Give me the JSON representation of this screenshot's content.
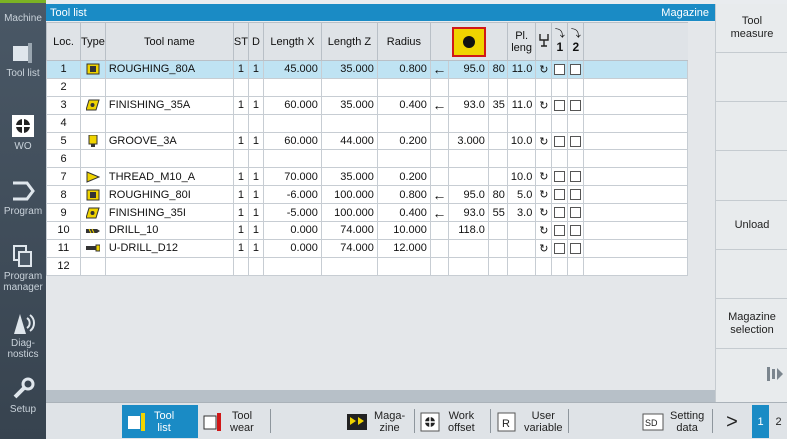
{
  "sidebar": {
    "items": [
      {
        "label": "Machine",
        "icon": "machine-icon"
      },
      {
        "label": "Tool list",
        "icon": "tool-list-icon"
      },
      {
        "label": "WO",
        "icon": "wo-icon"
      },
      {
        "label": "Program",
        "icon": "program-icon"
      },
      {
        "label": "Program\nmanager",
        "icon": "program-manager-icon"
      },
      {
        "label": "Diag-\nnostics",
        "icon": "diagnostics-icon"
      },
      {
        "label": "Setup",
        "icon": "setup-icon"
      }
    ]
  },
  "header": {
    "title": "Tool list",
    "right": "Magazine"
  },
  "table": {
    "columns": [
      "Loc.",
      "Type",
      "Tool name",
      "ST",
      "D",
      "Length X",
      "Length Z",
      "Radius",
      "",
      "Pl. leng",
      "",
      "1",
      "2"
    ],
    "rows": [
      {
        "loc": "1",
        "type": "roughing",
        "name": "ROUGHING_80A",
        "st": "1",
        "d": "1",
        "lx": "45.000",
        "lz": "35.000",
        "rad": "0.800",
        "dir": "←",
        "v1": "95.0",
        "v2": "80",
        "pl": "11.0",
        "sp": "↻",
        "selected": true
      },
      {
        "loc": "2",
        "type": "",
        "name": "",
        "st": "",
        "d": "",
        "lx": "",
        "lz": "",
        "rad": "",
        "dir": "",
        "v1": "",
        "v2": "",
        "pl": "",
        "sp": ""
      },
      {
        "loc": "3",
        "type": "finishing",
        "name": "FINISHING_35A",
        "st": "1",
        "d": "1",
        "lx": "60.000",
        "lz": "35.000",
        "rad": "0.400",
        "dir": "←",
        "v1": "93.0",
        "v2": "35",
        "pl": "11.0",
        "sp": "↻"
      },
      {
        "loc": "4",
        "type": "",
        "name": "",
        "st": "",
        "d": "",
        "lx": "",
        "lz": "",
        "rad": "",
        "dir": "",
        "v1": "",
        "v2": "",
        "pl": "",
        "sp": ""
      },
      {
        "loc": "5",
        "type": "groove",
        "name": "GROOVE_3A",
        "st": "1",
        "d": "1",
        "lx": "60.000",
        "lz": "44.000",
        "rad": "0.200",
        "dir": "",
        "v1": "3.000",
        "v2": "",
        "pl": "10.0",
        "sp": "↻"
      },
      {
        "loc": "6",
        "type": "",
        "name": "",
        "st": "",
        "d": "",
        "lx": "",
        "lz": "",
        "rad": "",
        "dir": "",
        "v1": "",
        "v2": "",
        "pl": "",
        "sp": ""
      },
      {
        "loc": "7",
        "type": "thread",
        "name": "THREAD_M10_A",
        "st": "1",
        "d": "1",
        "lx": "70.000",
        "lz": "35.000",
        "rad": "0.200",
        "dir": "",
        "v1": "",
        "v2": "",
        "pl": "10.0",
        "sp": "↻"
      },
      {
        "loc": "8",
        "type": "roughing",
        "name": "ROUGHING_80I",
        "st": "1",
        "d": "1",
        "lx": "-6.000",
        "lz": "100.000",
        "rad": "0.800",
        "dir": "←",
        "v1": "95.0",
        "v2": "80",
        "pl": "5.0",
        "sp": "↻"
      },
      {
        "loc": "9",
        "type": "finishing",
        "name": "FINISHING_35I",
        "st": "1",
        "d": "1",
        "lx": "-5.000",
        "lz": "100.000",
        "rad": "0.400",
        "dir": "←",
        "v1": "93.0",
        "v2": "55",
        "pl": "3.0",
        "sp": "↻"
      },
      {
        "loc": "10",
        "type": "drill",
        "name": "DRILL_10",
        "st": "1",
        "d": "1",
        "lx": "0.000",
        "lz": "74.000",
        "rad": "10.000",
        "dir": "",
        "v1": "118.0",
        "v2": "",
        "pl": "",
        "sp": "↻"
      },
      {
        "loc": "11",
        "type": "udrill",
        "name": "U-DRILL_D12",
        "st": "1",
        "d": "1",
        "lx": "0.000",
        "lz": "74.000",
        "rad": "12.000",
        "dir": "",
        "v1": "",
        "v2": "",
        "pl": "",
        "sp": "↻"
      },
      {
        "loc": "12",
        "type": "",
        "name": "",
        "st": "",
        "d": "",
        "lx": "",
        "lz": "",
        "rad": "",
        "dir": "",
        "v1": "",
        "v2": "",
        "pl": "",
        "sp": ""
      }
    ]
  },
  "softkeys": {
    "tool_measure": "Tool\nmeasure",
    "unload": "Unload",
    "magazine_selection": "Magazine\nselection"
  },
  "bottom": {
    "tool_list": "Tool\nlist",
    "tool_wear": "Tool\nwear",
    "magazine": "Maga-\nzine",
    "work_offset": "Work\noffset",
    "user_variable": "User\nvariable",
    "setting_data": "Setting\ndata",
    "more": ">",
    "page1": "1",
    "page2": "2"
  },
  "colors": {
    "accent": "#1a8bc5",
    "selection": "#bfe3f3",
    "tool_yellow": "#f0d400"
  }
}
